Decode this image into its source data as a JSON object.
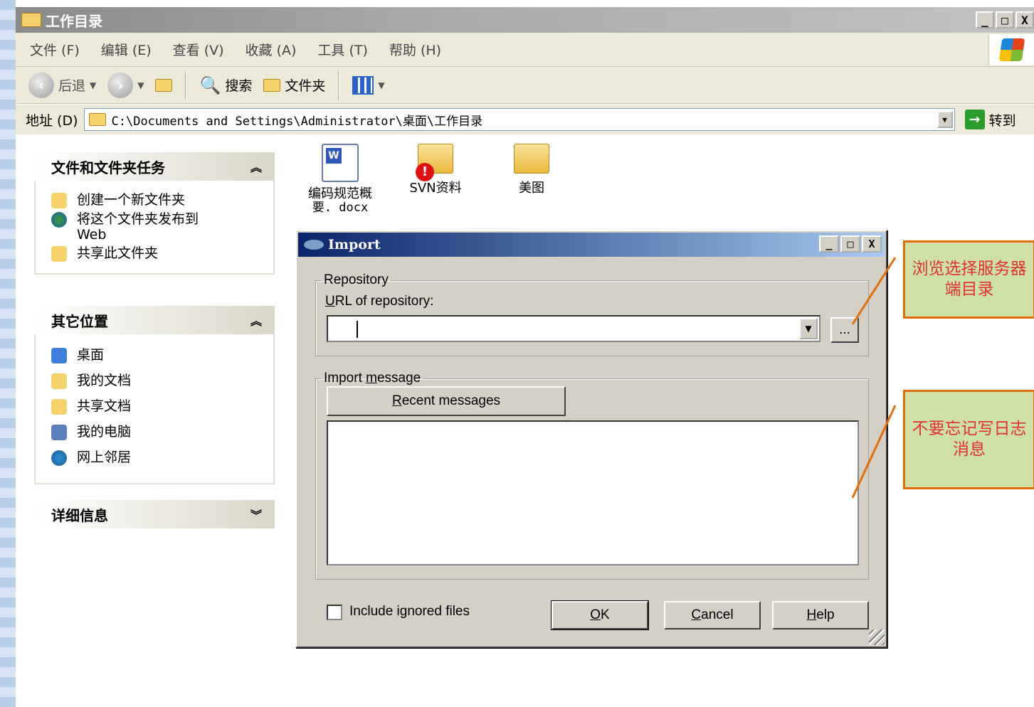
{
  "window": {
    "title": "工作目录",
    "min_btn": "_",
    "max_btn": "□",
    "close_btn": "X"
  },
  "menubar": {
    "items": [
      "文件 (F)",
      "编辑 (E)",
      "查看 (V)",
      "收藏 (A)",
      "工具 (T)",
      "帮助 (H)"
    ]
  },
  "toolbar": {
    "back_label": "后退",
    "search_label": "搜索",
    "folders_label": "文件夹"
  },
  "address": {
    "label": "地址 (D)",
    "path": "C:\\Documents and Settings\\Administrator\\桌面\\工作目录",
    "go_label": "转到"
  },
  "tasks_panel": {
    "title": "文件和文件夹任务",
    "items": [
      "创建一个新文件夹",
      "将这个文件夹发布到 Web",
      "共享此文件夹"
    ]
  },
  "places_panel": {
    "title": "其它位置",
    "items": [
      "桌面",
      "我的文档",
      "共享文档",
      "我的电脑",
      "网上邻居"
    ]
  },
  "details_panel": {
    "title": "详细信息"
  },
  "files": [
    {
      "name": "编码规范概要.docx",
      "line1": "编码规范概",
      "line2": "要. docx",
      "icon": "word-doc-icon"
    },
    {
      "name": "SVN资料",
      "icon": "folder-warning-icon"
    },
    {
      "name": "美图",
      "icon": "folder-icon"
    }
  ],
  "dialog": {
    "title": "Import",
    "repository_legend": "Repository",
    "url_label": "URL of repository:",
    "url_value": "",
    "browse_label": "...",
    "message_legend": "Import message",
    "recent_label": "Recent messages",
    "message_value": "",
    "include_ignored_label": "Include ignored files",
    "include_ignored_checked": false,
    "ok_label": "OK",
    "cancel_label": "Cancel",
    "help_label": "Help"
  },
  "callouts": [
    {
      "text": "浏览选择服务器端目录"
    },
    {
      "text": "不要忘记写日志消息"
    }
  ],
  "colors": {
    "callout_border": "#e06f0e",
    "callout_fill": "#cfe0a6",
    "callout_text": "#e03030",
    "dialog_title": "#0a246a"
  }
}
